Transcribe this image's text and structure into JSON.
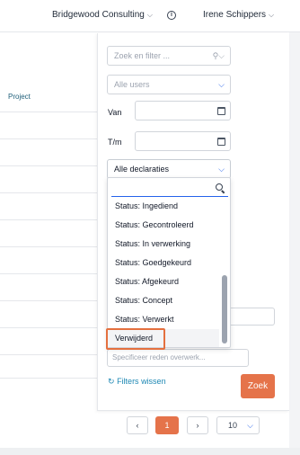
{
  "header": {
    "company": "Bridgewood Consulting",
    "user": "Irene Schippers"
  },
  "table": {
    "column_project": "Project"
  },
  "filters": {
    "search_placeholder": "Zoek en filter ...",
    "users_select": "Alle users",
    "from_label": "Van",
    "to_label": "T/m",
    "declaration_select": "Alle declaraties",
    "options": [
      "Status: Ingediend",
      "Status: Gecontroleerd",
      "Status: In verwerking",
      "Status: Goedgekeurd",
      "Status: Afgekeurd",
      "Status: Concept",
      "Status: Verwerkt",
      "Verwijderd"
    ],
    "reason_placeholder": "Specificeer reden overwerk...",
    "clear_label": "Filters wissen",
    "search_button": "Zoek"
  },
  "pagination": {
    "prev": "‹",
    "current_page": "1",
    "next": "›",
    "page_size": "10"
  },
  "colors": {
    "accent": "#e5734a",
    "link": "#1e88b4"
  }
}
